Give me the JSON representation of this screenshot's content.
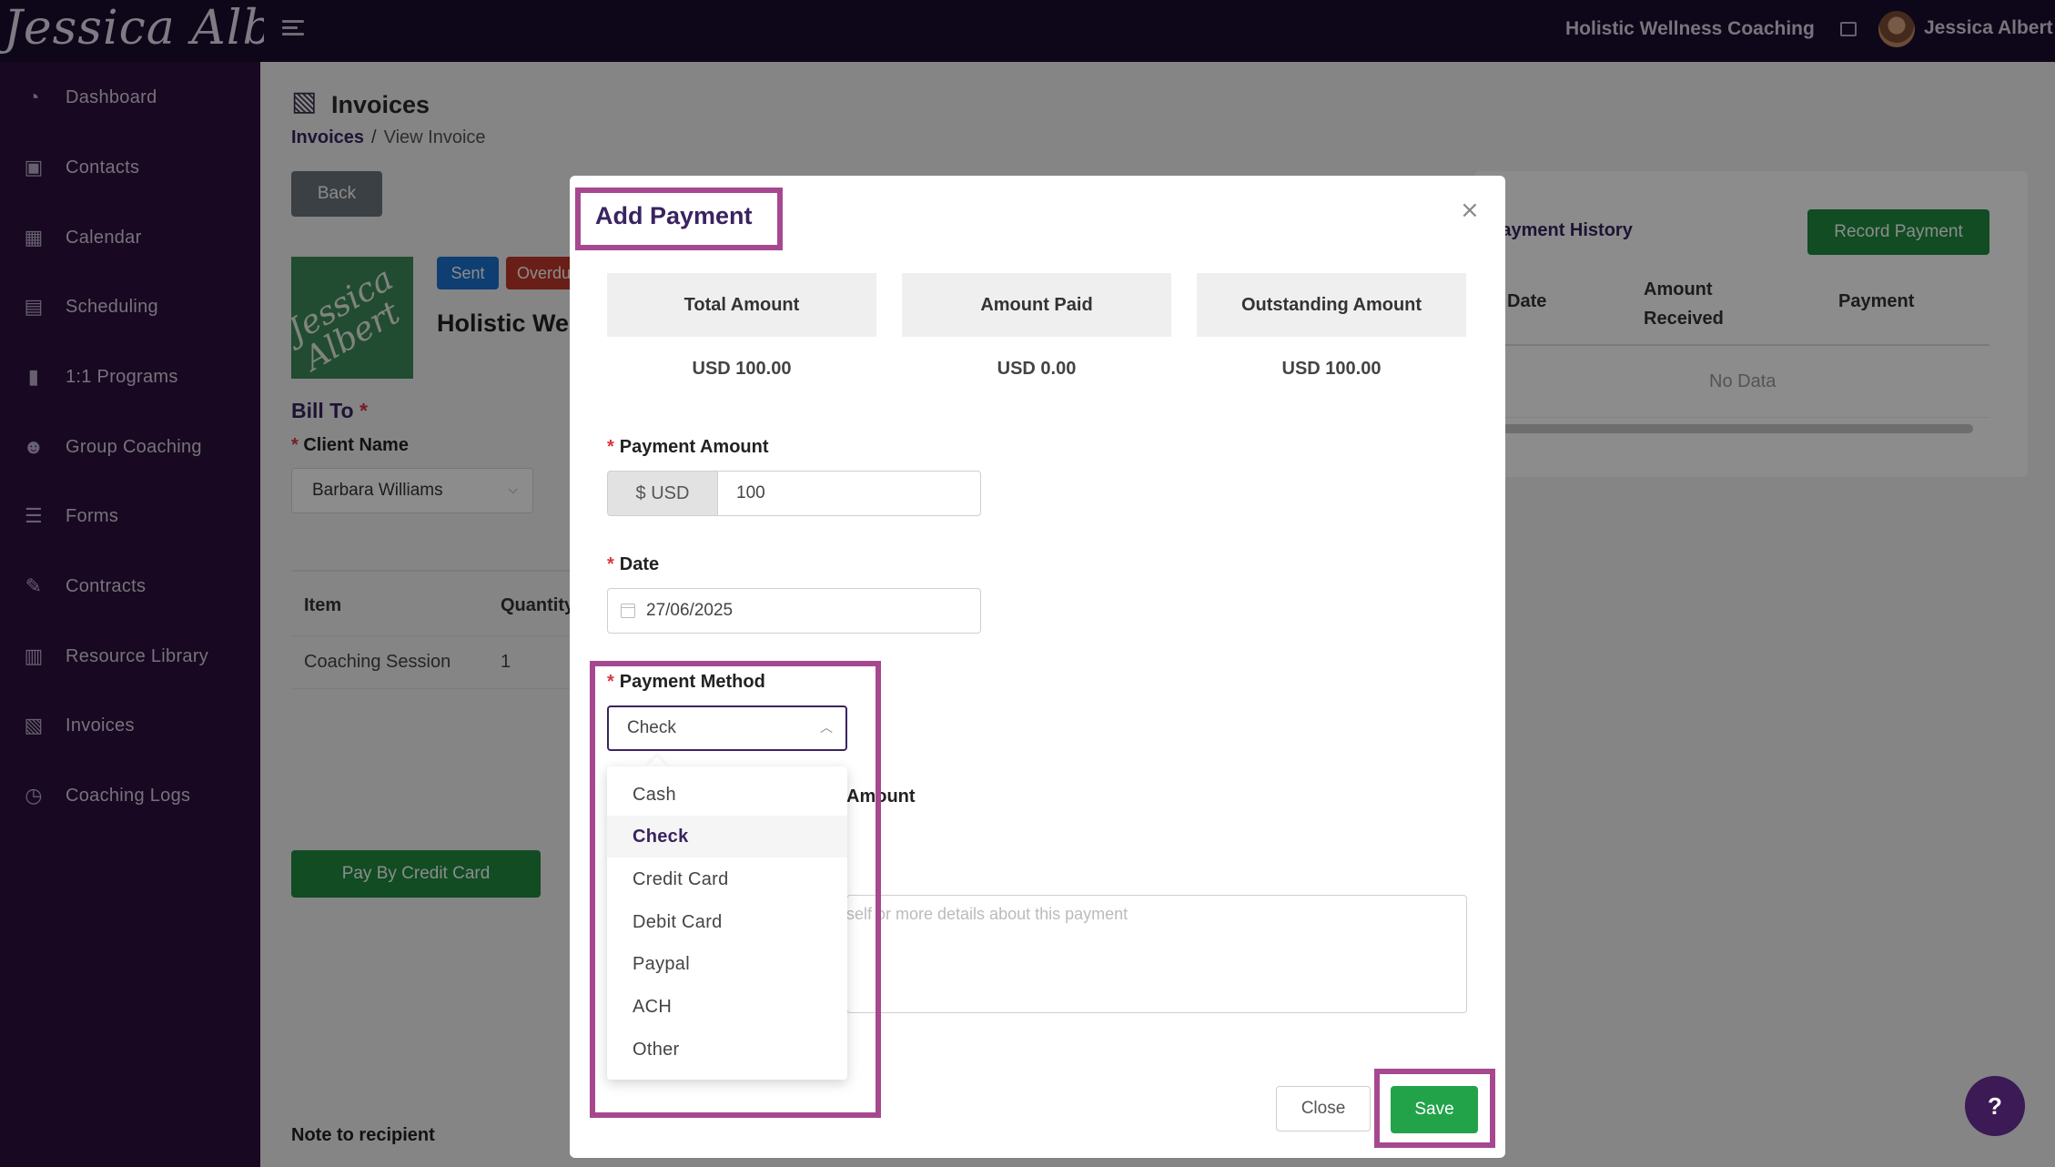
{
  "header": {
    "logo_text": "Jessica Albert",
    "business_name": "Holistic Wellness Coaching",
    "user_name": "Jessica Albert"
  },
  "sidebar": {
    "items": [
      {
        "label": "Dashboard",
        "icon": "dashboard-icon"
      },
      {
        "label": "Contacts",
        "icon": "contacts-icon"
      },
      {
        "label": "Calendar",
        "icon": "calendar-icon"
      },
      {
        "label": "Scheduling",
        "icon": "scheduling-icon"
      },
      {
        "label": "1:1 Programs",
        "icon": "book-icon"
      },
      {
        "label": "Group Coaching",
        "icon": "group-icon"
      },
      {
        "label": "Forms",
        "icon": "list-icon"
      },
      {
        "label": "Contracts",
        "icon": "contract-icon"
      },
      {
        "label": "Resource Library",
        "icon": "library-icon"
      },
      {
        "label": "Invoices",
        "icon": "invoice-icon"
      },
      {
        "label": "Coaching Logs",
        "icon": "clock-icon"
      }
    ]
  },
  "page": {
    "title": "Invoices",
    "breadcrumb": {
      "root": "Invoices",
      "separator": "/",
      "current": "View Invoice"
    },
    "back_label": "Back",
    "logo_text": "Jessica Albert",
    "badge_sent": "Sent",
    "badge_overdue": "Overdue",
    "business_title": "Holistic Wellness Coaching",
    "bill_to": "Bill To",
    "client_name_label": "Client Name",
    "client_name_value": "Barbara Williams",
    "table": {
      "headers": {
        "item": "Item",
        "quantity": "Quantity"
      },
      "rows": [
        {
          "item": "Coaching Session",
          "quantity": "1"
        }
      ]
    },
    "pay_by_credit_card": "Pay By Credit Card",
    "note_to_recipient": "Note to recipient"
  },
  "payment_history": {
    "title": "Payment History",
    "record_payment": "Record Payment",
    "headers": {
      "date": "Date",
      "amount_received": "Amount Received",
      "payment": "Payment"
    },
    "empty": "No Data"
  },
  "modal": {
    "title": "Add Payment",
    "close_x": "×",
    "summary": {
      "total_label": "Total Amount",
      "paid_label": "Amount Paid",
      "outstanding_label": "Outstanding Amount",
      "total_value": "USD 100.00",
      "paid_value": "USD 0.00",
      "outstanding_value": "USD 100.00"
    },
    "payment_amount_label": "Payment Amount",
    "currency_addon": "$ USD",
    "payment_amount_value": "100",
    "date_label": "Date",
    "date_value": "27/06/2025",
    "payment_method_label": "Payment Method",
    "payment_method_value": "Check",
    "payment_method_options": [
      "Cash",
      "Check",
      "Credit Card",
      "Debit Card",
      "Paypal",
      "ACH",
      "Other"
    ],
    "hidden_label_fragment": "Amount",
    "notes_placeholder_fragment": "self or more details about this payment",
    "close_button": "Close",
    "save_button": "Save"
  },
  "help_button": "?",
  "colors": {
    "accent": "#3a2360",
    "highlight": "#a6488f",
    "save_green": "#22a34a",
    "sidebar_bg": "#2c0f3c",
    "topbar_bg": "#1a0b2e"
  }
}
